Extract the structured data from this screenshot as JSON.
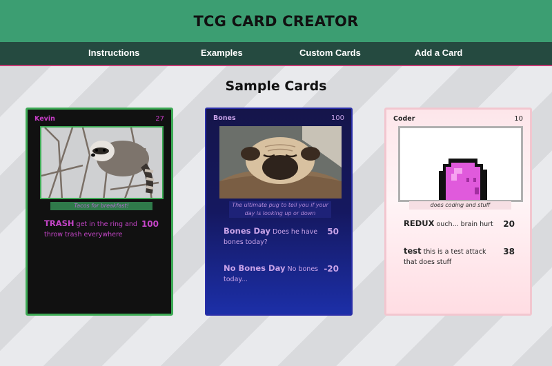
{
  "header": {
    "title": "TCG CARD CREATOR"
  },
  "nav": {
    "items": [
      {
        "label": "Instructions"
      },
      {
        "label": "Examples"
      },
      {
        "label": "Custom Cards"
      },
      {
        "label": "Add a Card"
      }
    ]
  },
  "main": {
    "section_title": "Sample Cards"
  },
  "cards": [
    {
      "name": "Kevin",
      "hp": "27",
      "image": "raccoon-photo",
      "description": "Tacos for breakfast!",
      "attacks": [
        {
          "name": "TRASH",
          "text": "get in the ring and throw trash everywhere",
          "damage": "100"
        }
      ]
    },
    {
      "name": "Bones",
      "hp": "100",
      "image": "pug-photo",
      "description": "The ultimate pug to tell you if your day is looking up or down",
      "attacks": [
        {
          "name": "Bones Day",
          "text": "Does he have bones today?",
          "damage": "50"
        },
        {
          "name": "No Bones Day",
          "text": "No bones today...",
          "damage": "-20"
        }
      ]
    },
    {
      "name": "Coder",
      "hp": "10",
      "image": "pink-pixel-blob",
      "description": "does coding and stuff",
      "attacks": [
        {
          "name": "REDUX",
          "text": "ouch... brain hurt",
          "damage": "20"
        },
        {
          "name": "test",
          "text": "this is a test attack that does stuff",
          "damage": "38"
        }
      ]
    }
  ],
  "colors": {
    "header_bg": "#3c9e72",
    "nav_bg": "#254a40",
    "nav_border": "#c23a72",
    "card1_border": "#3daa55",
    "card2_border": "#2a2ea8",
    "card3_border": "#f2c6cf",
    "card1_text": "#c545c8"
  }
}
